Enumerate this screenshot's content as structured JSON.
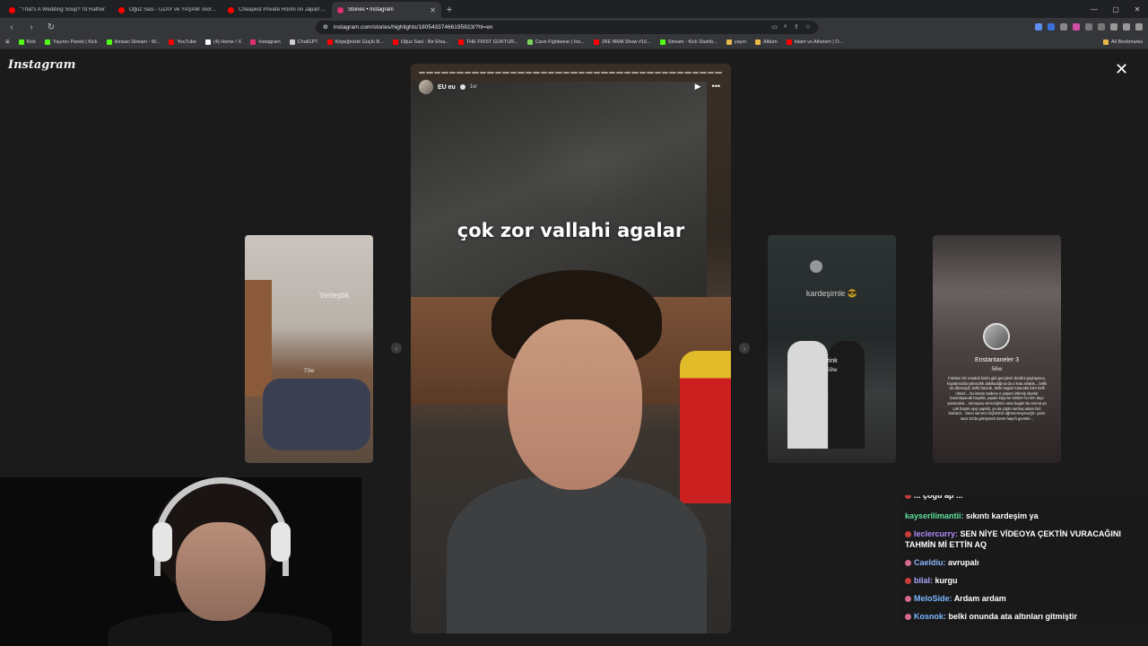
{
  "browser": {
    "tabs": [
      {
        "label": "\"That's A Wedding Soup? I'd Rather",
        "favicon_color": "#ff0000",
        "active": false
      },
      {
        "label": "Oğuz Sasi - UZAY ve YAŞAM Teorileri",
        "favicon_color": "#ff0000",
        "active": false
      },
      {
        "label": "Cheapest Private Room on Japan's O",
        "favicon_color": "#ff0000",
        "active": false
      },
      {
        "label": "Stories • Instagram",
        "favicon_color": "#e1306c",
        "active": true
      }
    ],
    "new_tab": "+",
    "window_controls": [
      "—",
      "▢",
      "✕"
    ],
    "url": "instagram.com/stories/highlights/18054337466195923/?hl=en",
    "bookmarks": [
      {
        "label": "Kick",
        "color": "#53fc18"
      },
      {
        "label": "Yayıncı Paneli | Kick",
        "color": "#53fc18"
      },
      {
        "label": "ikinsan Stream - W...",
        "color": "#53fc18"
      },
      {
        "label": "YouTube",
        "color": "#ff0000"
      },
      {
        "label": "(4) Home / X",
        "color": "#ffffff"
      },
      {
        "label": "Instagram",
        "color": "#e1306c"
      },
      {
        "label": "ChatGPT",
        "color": "#cccccc"
      },
      {
        "label": "Köpeğinizle Güçlü B...",
        "color": "#ff0000"
      },
      {
        "label": "Oğuz Sasi - Bir Efsa...",
        "color": "#ff0000"
      },
      {
        "label": "THE FIRST GOKTUR...",
        "color": "#ff0000"
      },
      {
        "label": "Cave Fightwear | Ins...",
        "color": "#7cd35a"
      },
      {
        "label": "JRE MMA Show #16...",
        "color": "#ff0000"
      },
      {
        "label": "Stream - Kick Dashb...",
        "color": "#53fc18"
      },
      {
        "label": "yayın",
        "color": "#e8b84a"
      },
      {
        "label": "Albüm",
        "color": "#e8b84a"
      },
      {
        "label": "Islam vs Atheism | O...",
        "color": "#ff0000"
      }
    ],
    "all_bookmarks": "All Bookmarks"
  },
  "instagram": {
    "logo": "Instagram",
    "close": "✕",
    "main_story": {
      "username": "EU eu",
      "age": "1w",
      "caption": "çok zor vallahi agalar",
      "segments": 40
    },
    "prev_story": {
      "title": "Yerleştik",
      "age": "73w"
    },
    "next_stories": [
      {
        "title": "kardeşimle 😎",
        "name": "zink",
        "age": "59w"
      },
      {
        "title": "Enstantaneler 3",
        "age": "56w",
        "body": "Fotoları biz ırmakdı bizim gibi gençlerin derdini paylaşınca, hayatımızda yakısızlık dakikadığına da o kısa anlatık... belki de dilenciydi, belki hazırdı, belki bugün tutacaktı bize belli olmaz... bu insanı sadece o yaşam izlemiş olanlar karanlayacak hayatla, yapan kaçıran trinkler bu kim dayı yazacaktır... sonraysa vereceğimiz ama bugün bu anıma ya çok büyük ayıp yapıldı, ya da çöplü sarhoş adam bizi kurtardı... bunu sanırım hiçbirimiz öğrenemeyeceğiz. yarın saat 10'da görüşmek üzere hayırlı geceler..."
      }
    ]
  },
  "chat": {
    "messages": [
      {
        "user": "",
        "text": "... çoğu ap ... ",
        "user_color": "#ff8b3d",
        "badge_color": "#c83d3d",
        "cut": true
      },
      {
        "user": "kayserilimantii:",
        "text": "sıkıntı kardeşim ya",
        "user_color": "#5fe0a0",
        "badge_color": "",
        "cut": false
      },
      {
        "user": "leclercurry:",
        "text": "SEN NİYE VİDEOYA ÇEKTİN VURACAĞINI TAHMİN Mİ ETTİN AQ",
        "user_color": "#b388ff",
        "badge_color": "#c83d3d",
        "cut": false
      },
      {
        "user": "Caeldiu:",
        "text": "avrupalı",
        "user_color": "#8ab4f8",
        "badge_color": "#d46a8a",
        "cut": false
      },
      {
        "user": "bilal:",
        "text": "kurgu",
        "user_color": "#a8a8ff",
        "badge_color": "#c83d3d",
        "cut": false
      },
      {
        "user": "MeloSide:",
        "text": "Ardam ardam",
        "user_color": "#7ab8ff",
        "badge_color": "#d46a8a",
        "cut": false
      },
      {
        "user": "Kosnok:",
        "text": "belki onunda ata altınları gitmiştir",
        "user_color": "#7ab8ff",
        "badge_color": "#d46a8a",
        "cut": false
      }
    ]
  }
}
